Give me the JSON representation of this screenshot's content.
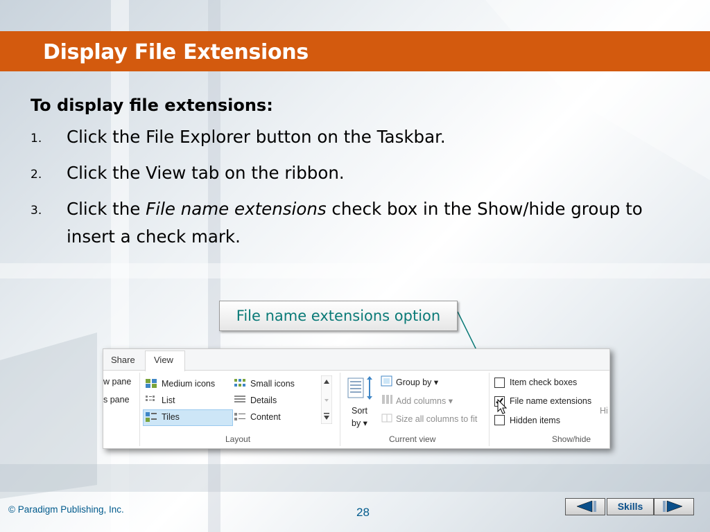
{
  "slide": {
    "title": "Display File Extensions",
    "heading": "To display file extensions:",
    "steps": [
      {
        "num": "1.",
        "text": "Click the File Explorer button on the Taskbar."
      },
      {
        "num": "2.",
        "text": "Click the View tab on the ribbon."
      },
      {
        "num": "3.",
        "pre": "Click the ",
        "italic": "File name extensions",
        "post": " check box in the Show/hide group to insert a check mark."
      }
    ],
    "callout": "File name extensions option"
  },
  "ribbon": {
    "tabs": [
      "Share",
      "View"
    ],
    "active_tab": "View",
    "panes": [
      "w pane",
      "s pane"
    ],
    "layout_items": [
      "Medium icons",
      "Small icons",
      "List",
      "Details",
      "Tiles",
      "Content"
    ],
    "selected_layout": "Tiles",
    "sort_label_1": "Sort",
    "sort_label_2": "by ▾",
    "current_view_items": [
      "Group by ▾",
      "Add columns ▾",
      "Size all columns to fit"
    ],
    "show_hide_items": [
      {
        "label": "Item check boxes",
        "checked": false
      },
      {
        "label": "File name extensions",
        "checked": true
      },
      {
        "label": "Hidden items",
        "checked": false
      }
    ],
    "cutoff_text": "Hi",
    "group_labels": {
      "layout": "Layout",
      "current_view": "Current view",
      "show_hide": "Show/hide"
    }
  },
  "footer": {
    "copyright": "© Paradigm Publishing, Inc.",
    "page": "28",
    "skills_label": "Skills"
  },
  "colors": {
    "title_bar": "#d35a0e",
    "callout_text": "#0a7a77",
    "footer_text": "#005a8c"
  }
}
